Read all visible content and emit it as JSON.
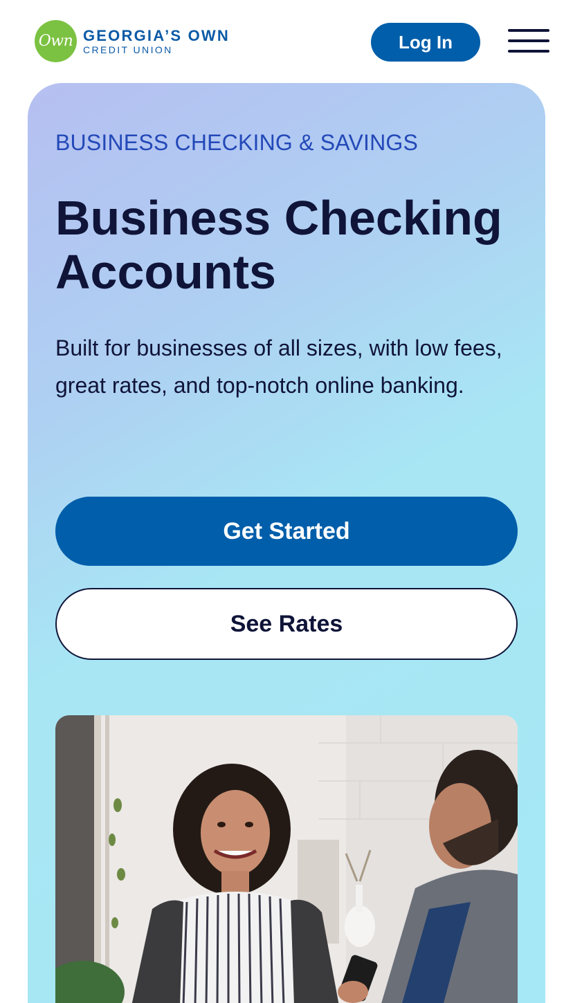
{
  "header": {
    "logo_mark": "Own",
    "logo_line1": "GEORGIA’S OWN",
    "logo_line2": "CREDIT UNION",
    "login_label": "Log In",
    "menu_icon": "hamburger-menu-icon"
  },
  "hero": {
    "eyebrow": "BUSINESS CHECKING & SAVINGS",
    "headline": "Business Checking Accounts",
    "description": "Built for businesses of all sizes, with low fees, great rates, and top-notch online banking.",
    "primary_cta": "Get Started",
    "secondary_cta": "See Rates"
  },
  "colors": {
    "brand_blue": "#005eaa",
    "brand_green": "#7cc242",
    "eyebrow_blue": "#2348b8",
    "navy_text": "#0f1438"
  }
}
